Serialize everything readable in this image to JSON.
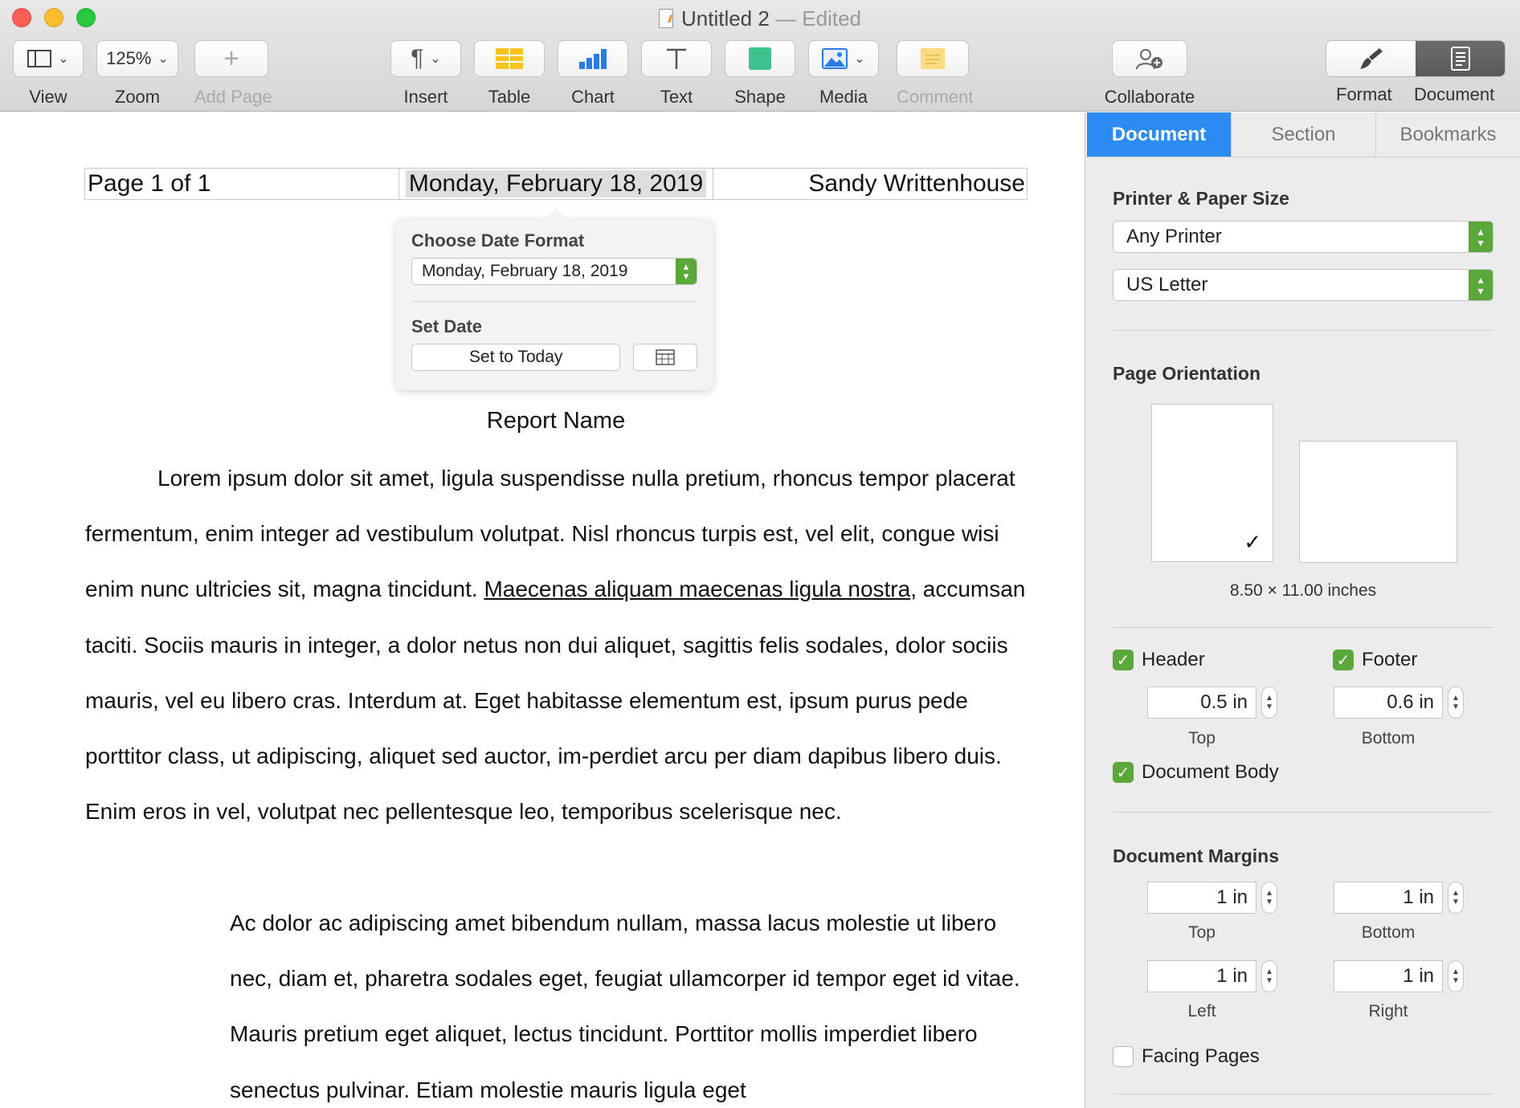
{
  "window": {
    "title": "Untitled 2",
    "edited": "— Edited"
  },
  "toolbar": {
    "view_label": "View",
    "zoom_value": "125%",
    "zoom_label": "Zoom",
    "add_page_label": "Add Page",
    "insert_label": "Insert",
    "table_label": "Table",
    "chart_label": "Chart",
    "text_label": "Text",
    "shape_label": "Shape",
    "media_label": "Media",
    "comment_label": "Comment",
    "collaborate_label": "Collaborate",
    "format_label": "Format",
    "document_label": "Document"
  },
  "document": {
    "header": {
      "left": "Page 1 of 1",
      "center": "Monday, February 18, 2019",
      "right": "Sandy Writtenhouse"
    },
    "date_popover": {
      "format_title": "Choose Date Format",
      "format_value": "Monday, February 18, 2019",
      "set_date_title": "Set Date",
      "set_today_button": "Set to Today"
    },
    "report_name": "Report Name",
    "paragraph1": {
      "before_link": "Lorem ipsum dolor sit amet, ligula suspendisse nulla pretium, rhoncus tempor placerat fermentum, enim integer ad vestibulum volutpat. Nisl rhoncus turpis est, vel elit, congue wisi enim nunc ultricies sit, magna tincidunt. ",
      "link": "Maecenas aliquam maecenas ligula nostra",
      "after_link": ", accumsan taciti. Sociis mauris in integer, a dolor netus non dui aliquet, sagittis felis sodales, dolor sociis mauris, vel eu libero cras. Interdum at. Eget habitasse elementum est, ipsum purus pede porttitor class, ut adipiscing, aliquet sed auctor, im-perdiet arcu per diam dapibus libero duis. Enim eros in vel, volutpat nec pellentesque leo, temporibus scelerisque nec."
    },
    "paragraph2": "Ac dolor ac adipiscing amet bibendum nullam, massa lacus molestie ut libero nec, diam et, pharetra sodales eget, feugiat ullamcorper id tempor eget id vitae. Mauris pretium eget aliquet, lectus tincidunt. Porttitor mollis imperdiet libero senectus pulvinar. Etiam molestie mauris ligula eget"
  },
  "inspector": {
    "tabs": [
      "Document",
      "Section",
      "Bookmarks"
    ],
    "active_tab": "Document",
    "printer_title": "Printer & Paper Size",
    "printer_value": "Any Printer",
    "paper_value": "US Letter",
    "orientation_title": "Page Orientation",
    "dimensions": "8.50 × 11.00 inches",
    "header_label": "Header",
    "footer_label": "Footer",
    "header_value": "0.5 in",
    "footer_value": "0.6 in",
    "top_label": "Top",
    "bottom_label": "Bottom",
    "body_label": "Document Body",
    "margins_title": "Document Margins",
    "margin_top": "1 in",
    "margin_bottom": "1 in",
    "margin_left": "1 in",
    "margin_right": "1 in",
    "left_label": "Left",
    "right_label": "Right",
    "facing_label": "Facing Pages"
  },
  "colors": {
    "accent": "#2d8cf3",
    "checkbox_green": "#5aa83a",
    "table_yellow": "#f7c41f",
    "shape_green": "#3ec28f",
    "chart_blue": "#2a7be4"
  }
}
